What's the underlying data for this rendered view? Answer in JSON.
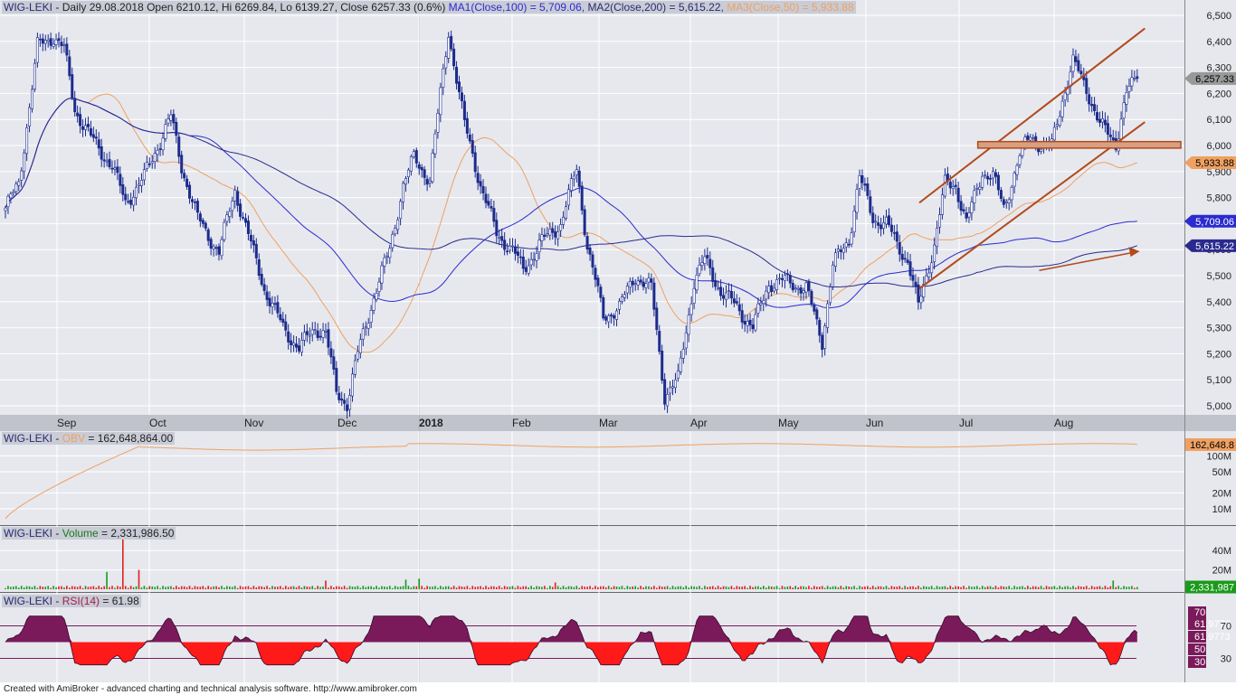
{
  "headers": {
    "price": {
      "name": "WIG-LEKI",
      "sep": " - ",
      "info": "Daily 29.08.2018 Open 6210.12, Hi 6269.84, Lo 6139.27, Close 6257.33 (0.6%)",
      "ma1": "MA1(Close,100) = 5,709.06,",
      "ma2": "MA2(Close,200) = 5,615.22,",
      "ma3": "MA3(Close,50) = 5,933.88"
    },
    "obv": {
      "name": "WIG-LEKI",
      "sep": " - ",
      "label": "OBV",
      "value": " = 162,648,864.00"
    },
    "volume": {
      "name": "WIG-LEKI",
      "sep": " - ",
      "label": "Volume",
      "value": " = 2,331,986.50"
    },
    "rsi": {
      "name": "WIG-LEKI",
      "sep": " - ",
      "label": "RSI(14)",
      "value": " = 61.98"
    }
  },
  "footer": "Created with AmiBroker - advanced charting and technical analysis software. http://www.amibroker.com",
  "colors": {
    "background": "#e6e8ee",
    "grid": "#ffffff",
    "candle_body": "#1c2b8c",
    "candle_up": "#ffffff",
    "ma50": "#f0a060",
    "ma100": "#2b2bd0",
    "ma200": "#2a2a8e",
    "channel": "#b34a1a",
    "obv": "#f0a060",
    "vol_up": "#1a9a1a",
    "vol_down": "#e02020",
    "rsi_line": "#7a1a5a",
    "rsi_fill_up": "#7a1a5a",
    "rsi_fill_down": "#ff1a1a"
  },
  "chart_data": [
    {
      "type": "candlestick",
      "panel": "price",
      "x_axis": {
        "months": [
          "Sep",
          "Oct",
          "Nov",
          "Dec",
          "2018",
          "Feb",
          "Mar",
          "Apr",
          "May",
          "Jun",
          "Jul",
          "Aug"
        ]
      },
      "y_ticks": [
        "6,500",
        "6,400",
        "6,300",
        "6,200",
        "6,100",
        "6,000",
        "5,900",
        "5,800",
        "5,700",
        "5,600",
        "5,500",
        "5,400",
        "5,300",
        "5,200",
        "5,100",
        "5,000"
      ],
      "ylim": [
        4980,
        6520
      ],
      "value_labels": {
        "close": "6,257.33",
        "ma50": "5,933.88",
        "ma100": "5,709.06",
        "ma200": "5,615.22"
      },
      "last_close": 6257.33,
      "ma50_last": 5933.88,
      "ma100_last": 5709.06,
      "ma200_last": 5615.22,
      "price_path": [
        [
          0,
          5760
        ],
        [
          5,
          5850
        ],
        [
          12,
          6380
        ],
        [
          18,
          6420
        ],
        [
          22,
          6370
        ],
        [
          26,
          6140
        ],
        [
          32,
          6030
        ],
        [
          40,
          5920
        ],
        [
          45,
          5780
        ],
        [
          52,
          5880
        ],
        [
          58,
          6020
        ],
        [
          62,
          6110
        ],
        [
          66,
          5920
        ],
        [
          72,
          5720
        ],
        [
          80,
          5590
        ],
        [
          86,
          5830
        ],
        [
          92,
          5620
        ],
        [
          97,
          5450
        ],
        [
          104,
          5300
        ],
        [
          110,
          5220
        ],
        [
          116,
          5300
        ],
        [
          120,
          5280
        ],
        [
          124,
          5050
        ],
        [
          128,
          5010
        ],
        [
          132,
          5200
        ],
        [
          138,
          5420
        ],
        [
          144,
          5600
        ],
        [
          149,
          5850
        ],
        [
          153,
          5950
        ],
        [
          159,
          5870
        ],
        [
          166,
          6440
        ],
        [
          172,
          6080
        ],
        [
          178,
          5850
        ],
        [
          184,
          5660
        ],
        [
          190,
          5600
        ],
        [
          194,
          5520
        ],
        [
          200,
          5620
        ],
        [
          208,
          5700
        ],
        [
          214,
          5910
        ],
        [
          218,
          5620
        ],
        [
          224,
          5340
        ],
        [
          230,
          5380
        ],
        [
          236,
          5500
        ],
        [
          242,
          5450
        ],
        [
          247,
          5040
        ],
        [
          252,
          5100
        ],
        [
          258,
          5480
        ],
        [
          262,
          5560
        ],
        [
          268,
          5440
        ],
        [
          274,
          5380
        ],
        [
          280,
          5300
        ],
        [
          286,
          5470
        ],
        [
          292,
          5480
        ],
        [
          300,
          5450
        ],
        [
          306,
          5250
        ],
        [
          310,
          5540
        ],
        [
          316,
          5640
        ],
        [
          320,
          5880
        ],
        [
          325,
          5720
        ],
        [
          330,
          5700
        ],
        [
          334,
          5620
        ],
        [
          338,
          5560
        ],
        [
          342,
          5380
        ],
        [
          348,
          5620
        ],
        [
          352,
          5850
        ],
        [
          356,
          5850
        ],
        [
          360,
          5700
        ],
        [
          366,
          5900
        ],
        [
          370,
          5880
        ],
        [
          374,
          5760
        ],
        [
          380,
          5960
        ],
        [
          384,
          6040
        ],
        [
          388,
          6000
        ],
        [
          392,
          6000
        ],
        [
          396,
          6180
        ],
        [
          400,
          6320
        ],
        [
          405,
          6220
        ],
        [
          410,
          6080
        ],
        [
          416,
          6010
        ],
        [
          420,
          6200
        ],
        [
          424,
          6257.33
        ]
      ],
      "channel_lines": [
        {
          "from": [
            "Jun",
            5780
          ],
          "to": [
            "Aug",
            6450
          ]
        },
        {
          "from": [
            "Jun",
            5450
          ],
          "to": [
            "Aug",
            6090
          ]
        }
      ],
      "support_zone": [
        5990,
        6015
      ],
      "trend_arrow": {
        "from": [
          "Jul",
          5520
        ],
        "to": [
          "Aug",
          5590
        ]
      }
    },
    {
      "type": "line",
      "panel": "obv",
      "y_ticks": [
        "100M",
        "50M",
        "20M",
        "10M"
      ],
      "value_label": "162,648.8",
      "last_value": 162648864.0
    },
    {
      "type": "bar",
      "panel": "volume",
      "y_ticks": [
        "40M",
        "20M"
      ],
      "value_label": "2,331,987",
      "last_value": 2331986.5,
      "spikes_M": [
        {
          "i": 38,
          "v": 18,
          "up": true
        },
        {
          "i": 44,
          "v": 55,
          "up": false
        },
        {
          "i": 50,
          "v": 20,
          "up": false
        },
        {
          "i": 120,
          "v": 9,
          "up": false
        },
        {
          "i": 150,
          "v": 10,
          "up": true
        },
        {
          "i": 155,
          "v": 11,
          "up": true
        },
        {
          "i": 206,
          "v": 7,
          "up": false
        },
        {
          "i": 415,
          "v": 9,
          "up": true
        }
      ]
    },
    {
      "type": "area",
      "panel": "rsi",
      "levels": [
        70,
        30
      ],
      "axis_labels": [
        "70",
        "61.9773",
        "61.9773",
        "50",
        "30"
      ],
      "last_value": 61.98
    }
  ]
}
